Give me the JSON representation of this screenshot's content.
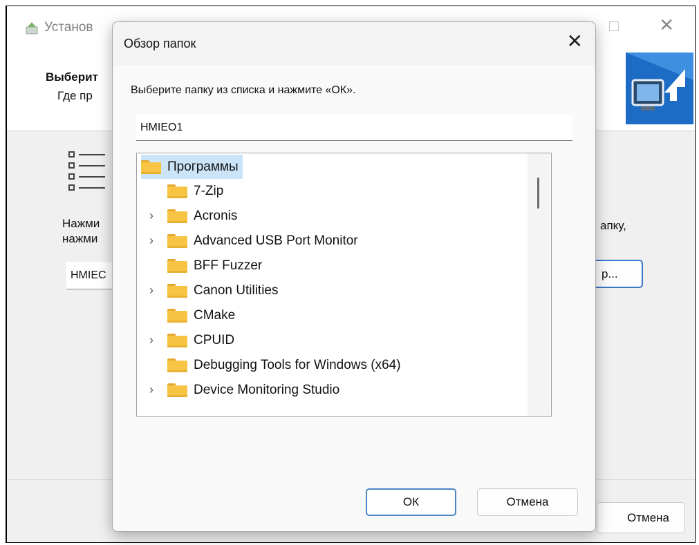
{
  "outer_window": {
    "title": "Установ",
    "heading": "Выберит",
    "subheading": "Где пр",
    "instruction_line1": "Нажми",
    "instruction_line2": "нажми",
    "instruction_right": "апку,",
    "path_value": "HMIEC",
    "browse_label": "р...",
    "cancel_label": "Отмена",
    "icons": [
      "installer-icon",
      "close-icon",
      "restore-icon",
      "banner-install-icon",
      "list-icon"
    ]
  },
  "dialog": {
    "title": "Обзор папок",
    "prompt": "Выберите папку из списка и нажмите «ОК».",
    "folder_value": "HMIEO1",
    "ok_label": "ОК",
    "cancel_label": "Отмена",
    "root": "Программы",
    "folders": [
      {
        "name": "7-Zip",
        "expandable": false
      },
      {
        "name": "Acronis",
        "expandable": true
      },
      {
        "name": "Advanced USB Port Monitor",
        "expandable": true
      },
      {
        "name": "BFF Fuzzer",
        "expandable": false
      },
      {
        "name": "Canon Utilities",
        "expandable": true
      },
      {
        "name": "CMake",
        "expandable": false
      },
      {
        "name": "CPUID",
        "expandable": true
      },
      {
        "name": "Debugging Tools for Windows (x64)",
        "expandable": false
      },
      {
        "name": "Device Monitoring Studio",
        "expandable": true
      }
    ],
    "colors": {
      "selection": "#cce4f7",
      "accent": "#4a85c6",
      "folder": "#f7c543"
    }
  }
}
